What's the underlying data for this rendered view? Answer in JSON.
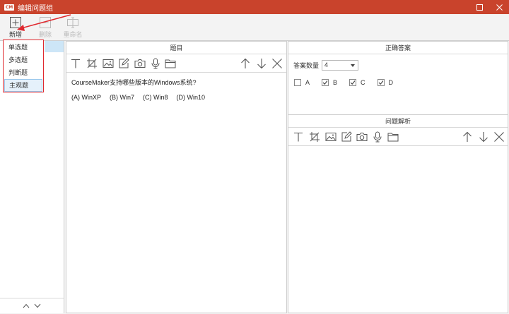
{
  "window": {
    "logo_text": "CM",
    "title": "编辑问题组"
  },
  "toolbar": {
    "add_label": "新增",
    "delete_label": "删除",
    "rename_label": "重命名"
  },
  "question_types": [
    {
      "label": "单选题"
    },
    {
      "label": "多选题"
    },
    {
      "label": "判断题"
    },
    {
      "label": "主观题"
    }
  ],
  "question_panel": {
    "title": "题目",
    "question": "CourseMaker支持哪些版本的Windows系统?",
    "options": [
      "(A) WinXP",
      "(B) Win7",
      "(C) Win8",
      "(D) Win10"
    ]
  },
  "answer_panel": {
    "title": "正确答案",
    "count_label": "答案数量",
    "count_value": "4",
    "choices": [
      {
        "label": "A",
        "checked": false
      },
      {
        "label": "B",
        "checked": true
      },
      {
        "label": "C",
        "checked": true
      },
      {
        "label": "D",
        "checked": true
      }
    ]
  },
  "analysis_panel": {
    "title": "问题解析"
  },
  "colors": {
    "titlebar": "#c9432c",
    "annotation": "#e0282e",
    "selection": "#cde6f7"
  }
}
